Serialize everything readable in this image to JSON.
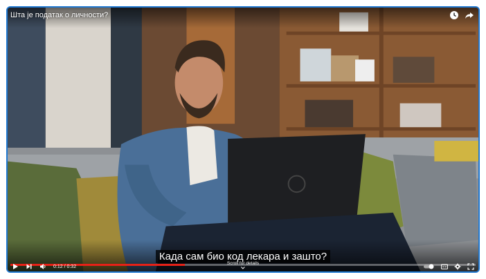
{
  "video": {
    "title": "Шта је податак о личности?",
    "subtitle": "Када сам био код лекара и зашто?",
    "time_display": "0:12 / 0:32",
    "progress_fraction": 0.375,
    "scroll_hint": "Scroll for details"
  },
  "icons": {
    "watch_later": "clock-icon",
    "share": "share-icon",
    "play": "play-icon",
    "next": "next-icon",
    "volume": "volume-icon",
    "autoplay": "autoplay-toggle-icon",
    "captions": "captions-icon",
    "settings": "gear-icon",
    "fullscreen": "fullscreen-icon",
    "scroll": "chevron-down-icon"
  },
  "colors": {
    "frame_border": "#1f78d1",
    "progress": "#e62117"
  }
}
